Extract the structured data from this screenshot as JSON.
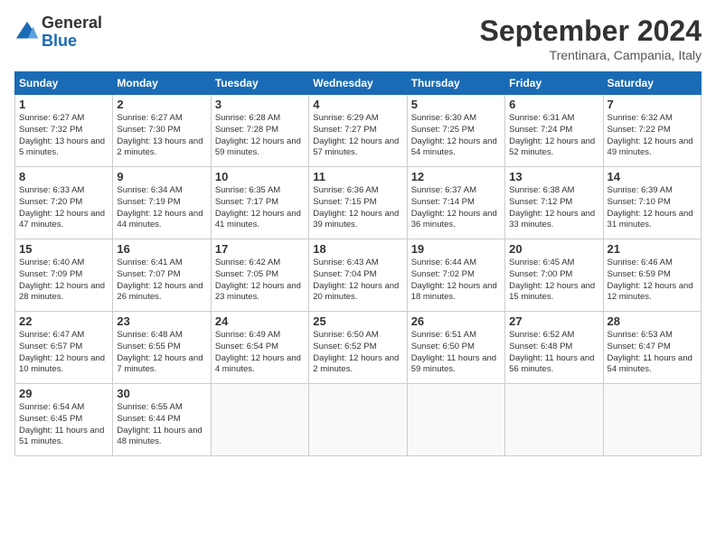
{
  "logo": {
    "general": "General",
    "blue": "Blue"
  },
  "title": "September 2024",
  "location": "Trentinara, Campania, Italy",
  "weekdays": [
    "Sunday",
    "Monday",
    "Tuesday",
    "Wednesday",
    "Thursday",
    "Friday",
    "Saturday"
  ],
  "weeks": [
    [
      {
        "day": "1",
        "sunrise": "6:27 AM",
        "sunset": "7:32 PM",
        "daylight": "13 hours and 5 minutes."
      },
      {
        "day": "2",
        "sunrise": "6:27 AM",
        "sunset": "7:30 PM",
        "daylight": "13 hours and 2 minutes."
      },
      {
        "day": "3",
        "sunrise": "6:28 AM",
        "sunset": "7:28 PM",
        "daylight": "12 hours and 59 minutes."
      },
      {
        "day": "4",
        "sunrise": "6:29 AM",
        "sunset": "7:27 PM",
        "daylight": "12 hours and 57 minutes."
      },
      {
        "day": "5",
        "sunrise": "6:30 AM",
        "sunset": "7:25 PM",
        "daylight": "12 hours and 54 minutes."
      },
      {
        "day": "6",
        "sunrise": "6:31 AM",
        "sunset": "7:24 PM",
        "daylight": "12 hours and 52 minutes."
      },
      {
        "day": "7",
        "sunrise": "6:32 AM",
        "sunset": "7:22 PM",
        "daylight": "12 hours and 49 minutes."
      }
    ],
    [
      {
        "day": "8",
        "sunrise": "6:33 AM",
        "sunset": "7:20 PM",
        "daylight": "12 hours and 47 minutes."
      },
      {
        "day": "9",
        "sunrise": "6:34 AM",
        "sunset": "7:19 PM",
        "daylight": "12 hours and 44 minutes."
      },
      {
        "day": "10",
        "sunrise": "6:35 AM",
        "sunset": "7:17 PM",
        "daylight": "12 hours and 41 minutes."
      },
      {
        "day": "11",
        "sunrise": "6:36 AM",
        "sunset": "7:15 PM",
        "daylight": "12 hours and 39 minutes."
      },
      {
        "day": "12",
        "sunrise": "6:37 AM",
        "sunset": "7:14 PM",
        "daylight": "12 hours and 36 minutes."
      },
      {
        "day": "13",
        "sunrise": "6:38 AM",
        "sunset": "7:12 PM",
        "daylight": "12 hours and 33 minutes."
      },
      {
        "day": "14",
        "sunrise": "6:39 AM",
        "sunset": "7:10 PM",
        "daylight": "12 hours and 31 minutes."
      }
    ],
    [
      {
        "day": "15",
        "sunrise": "6:40 AM",
        "sunset": "7:09 PM",
        "daylight": "12 hours and 28 minutes."
      },
      {
        "day": "16",
        "sunrise": "6:41 AM",
        "sunset": "7:07 PM",
        "daylight": "12 hours and 26 minutes."
      },
      {
        "day": "17",
        "sunrise": "6:42 AM",
        "sunset": "7:05 PM",
        "daylight": "12 hours and 23 minutes."
      },
      {
        "day": "18",
        "sunrise": "6:43 AM",
        "sunset": "7:04 PM",
        "daylight": "12 hours and 20 minutes."
      },
      {
        "day": "19",
        "sunrise": "6:44 AM",
        "sunset": "7:02 PM",
        "daylight": "12 hours and 18 minutes."
      },
      {
        "day": "20",
        "sunrise": "6:45 AM",
        "sunset": "7:00 PM",
        "daylight": "12 hours and 15 minutes."
      },
      {
        "day": "21",
        "sunrise": "6:46 AM",
        "sunset": "6:59 PM",
        "daylight": "12 hours and 12 minutes."
      }
    ],
    [
      {
        "day": "22",
        "sunrise": "6:47 AM",
        "sunset": "6:57 PM",
        "daylight": "12 hours and 10 minutes."
      },
      {
        "day": "23",
        "sunrise": "6:48 AM",
        "sunset": "6:55 PM",
        "daylight": "12 hours and 7 minutes."
      },
      {
        "day": "24",
        "sunrise": "6:49 AM",
        "sunset": "6:54 PM",
        "daylight": "12 hours and 4 minutes."
      },
      {
        "day": "25",
        "sunrise": "6:50 AM",
        "sunset": "6:52 PM",
        "daylight": "12 hours and 2 minutes."
      },
      {
        "day": "26",
        "sunrise": "6:51 AM",
        "sunset": "6:50 PM",
        "daylight": "11 hours and 59 minutes."
      },
      {
        "day": "27",
        "sunrise": "6:52 AM",
        "sunset": "6:48 PM",
        "daylight": "11 hours and 56 minutes."
      },
      {
        "day": "28",
        "sunrise": "6:53 AM",
        "sunset": "6:47 PM",
        "daylight": "11 hours and 54 minutes."
      }
    ],
    [
      {
        "day": "29",
        "sunrise": "6:54 AM",
        "sunset": "6:45 PM",
        "daylight": "11 hours and 51 minutes."
      },
      {
        "day": "30",
        "sunrise": "6:55 AM",
        "sunset": "6:44 PM",
        "daylight": "11 hours and 48 minutes."
      },
      null,
      null,
      null,
      null,
      null
    ]
  ]
}
